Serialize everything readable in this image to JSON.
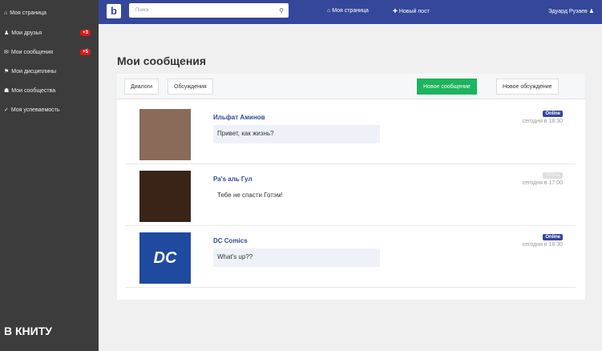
{
  "sidebar": {
    "items": [
      {
        "icon": "home-icon",
        "glyph": "⌂",
        "label": "Моя страница"
      },
      {
        "icon": "user-icon",
        "glyph": "♟",
        "label": "Мои друзья",
        "badge": "+3"
      },
      {
        "icon": "envelope-icon",
        "glyph": "✉",
        "label": "Мои сообщения",
        "badge": "+5"
      },
      {
        "icon": "graduation-cap-icon",
        "glyph": "⚑",
        "label": "Мои дисциплины"
      },
      {
        "icon": "group-icon",
        "glyph": "☗",
        "label": "Мои сообщества"
      },
      {
        "icon": "check-icon",
        "glyph": "✓",
        "label": "Моя успеваемость"
      }
    ],
    "brand": "В КНИТУ"
  },
  "topbar": {
    "logo": "b",
    "search_placeholder": "Поиск",
    "nav": [
      {
        "glyph": "⌂",
        "label": "Моя страница"
      },
      {
        "glyph": "✚",
        "label": "Новый пост"
      }
    ],
    "user": "Эдуард Рузаев"
  },
  "page": {
    "title": "Мои сообщения",
    "tabs": [
      "Диалоги",
      "Обсуждения"
    ],
    "new_message": "Новое сообщение",
    "new_discussion": "Новое обсуждение"
  },
  "messages": [
    {
      "name": "Ильфат Аминов",
      "text": "Привет, как жизнь?",
      "status": "Online",
      "online": true,
      "time": "сегодня в 18:30",
      "highlight": true,
      "avatar_color": "#8a6b5a"
    },
    {
      "name": "Ра's аль Гул",
      "text": "Тебе не спасти Готэм!",
      "status": "Offline",
      "online": false,
      "time": "сегодня в 17:00",
      "highlight": false,
      "avatar_color": "#3a2418"
    },
    {
      "name": "DC Comics",
      "text": "What's up??",
      "status": "Online",
      "online": true,
      "time": "сегодня в 18:30",
      "highlight": true,
      "avatar_color": "#1f4aa0",
      "avatar_text": "DC"
    }
  ]
}
